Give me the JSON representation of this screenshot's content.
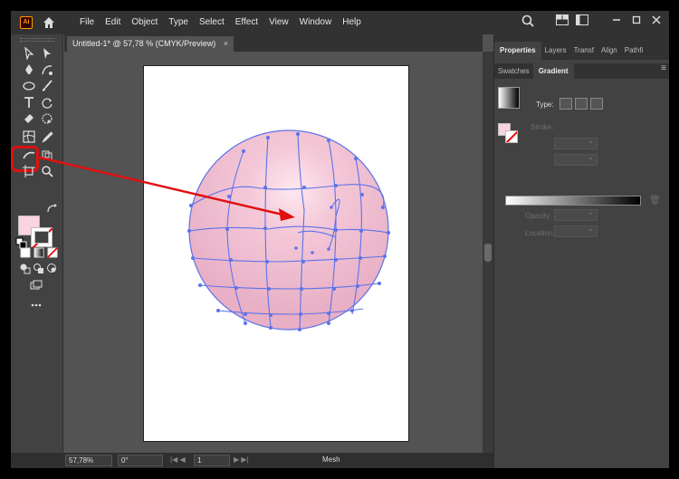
{
  "app": {
    "logo_text": "Ai"
  },
  "menu": [
    "File",
    "Edit",
    "Object",
    "Type",
    "Select",
    "Effect",
    "View",
    "Window",
    "Help"
  ],
  "document_tab": {
    "title": "Untitled-1* @ 57,78 % (CMYK/Preview)",
    "close": "×"
  },
  "panel": {
    "tabs": [
      "Properties",
      "Layers",
      "Transf",
      "Align",
      "Pathfi"
    ],
    "active_tab": "Properties",
    "subtabs": [
      "Swatches",
      "Gradient"
    ],
    "active_subtab": "Gradient",
    "type_label": "Type:",
    "stroke_label": "Stroke:",
    "opacity_label": "Opacity:",
    "location_label": "Location:"
  },
  "status": {
    "zoom": "57,78%",
    "rotation": "0°",
    "artboard": "1",
    "tool": "Mesh"
  },
  "colors": {
    "accent_red": "#e01010",
    "mesh_line": "#5b73ea",
    "fill_pink": "#f9d4df",
    "ball_pink": "#eab5c8"
  }
}
